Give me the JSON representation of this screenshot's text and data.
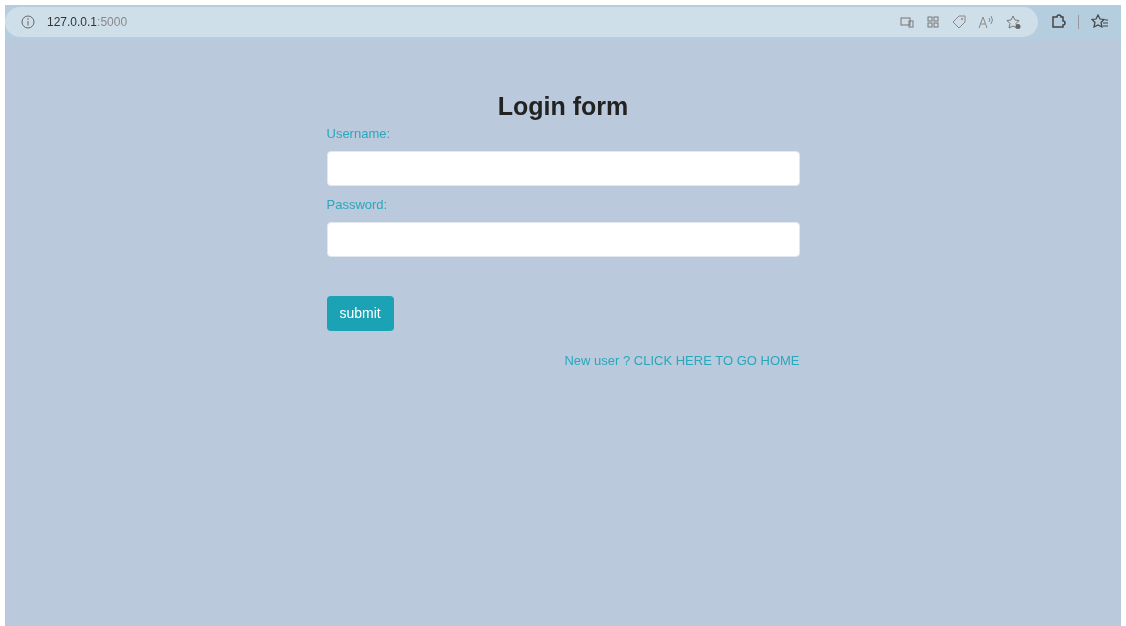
{
  "browser": {
    "address": "**127.0.0.1**:5000"
  },
  "form": {
    "title": "Login form",
    "fields": [
      {
        "label": "Username:"
      },
      {
        "label": "Password:"
      }
    ],
    "submit": "submit",
    "link": "New user ? CLICK HERE TO GO HOME"
  }
}
